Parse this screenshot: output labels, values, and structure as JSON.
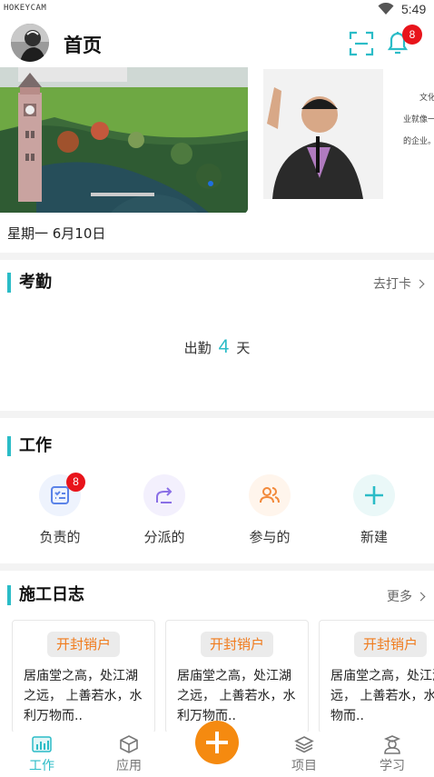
{
  "status_bar": {
    "watermark": "HOKEYCAM",
    "time": "5:49"
  },
  "header": {
    "title": "首页",
    "notification_count": "8"
  },
  "banner": {
    "next_slide_lines": [
      "文化",
      "业就像一",
      "的企业。"
    ]
  },
  "date": "星期一  6月10日",
  "attendance": {
    "title": "考勤",
    "action": "去打卡",
    "prefix": "出勤",
    "count": "4",
    "suffix": "天"
  },
  "work": {
    "title": "工作",
    "items": [
      {
        "label": "负责的",
        "icon": "checklist-icon",
        "badge": "8"
      },
      {
        "label": "分派的",
        "icon": "share-arrow-icon"
      },
      {
        "label": "参与的",
        "icon": "people-icon"
      },
      {
        "label": "新建",
        "icon": "plus-icon"
      }
    ]
  },
  "log": {
    "title": "施工日志",
    "more": "更多",
    "cards": [
      {
        "tag": "开封销户",
        "text": "居庙堂之高，处江湖之远， 上善若水，水利万物而.."
      },
      {
        "tag": "开封销户",
        "text": "居庙堂之高，处江湖之远， 上善若水，水利万物而.."
      },
      {
        "tag": "开封销户",
        "text": "居庙堂之高，处江湖之远， 上善若水，水利万物而.."
      }
    ]
  },
  "tabbar": {
    "items": [
      {
        "label": "工作",
        "icon": "chart-icon"
      },
      {
        "label": "应用",
        "icon": "cube-icon"
      },
      {
        "label": "项目",
        "icon": "layers-icon"
      },
      {
        "label": "学习",
        "icon": "learner-icon"
      }
    ]
  },
  "colors": {
    "accent": "#2bbcc7",
    "fab": "#f58a10",
    "badge": "#e8141b",
    "tag_text": "#f07b1d"
  }
}
